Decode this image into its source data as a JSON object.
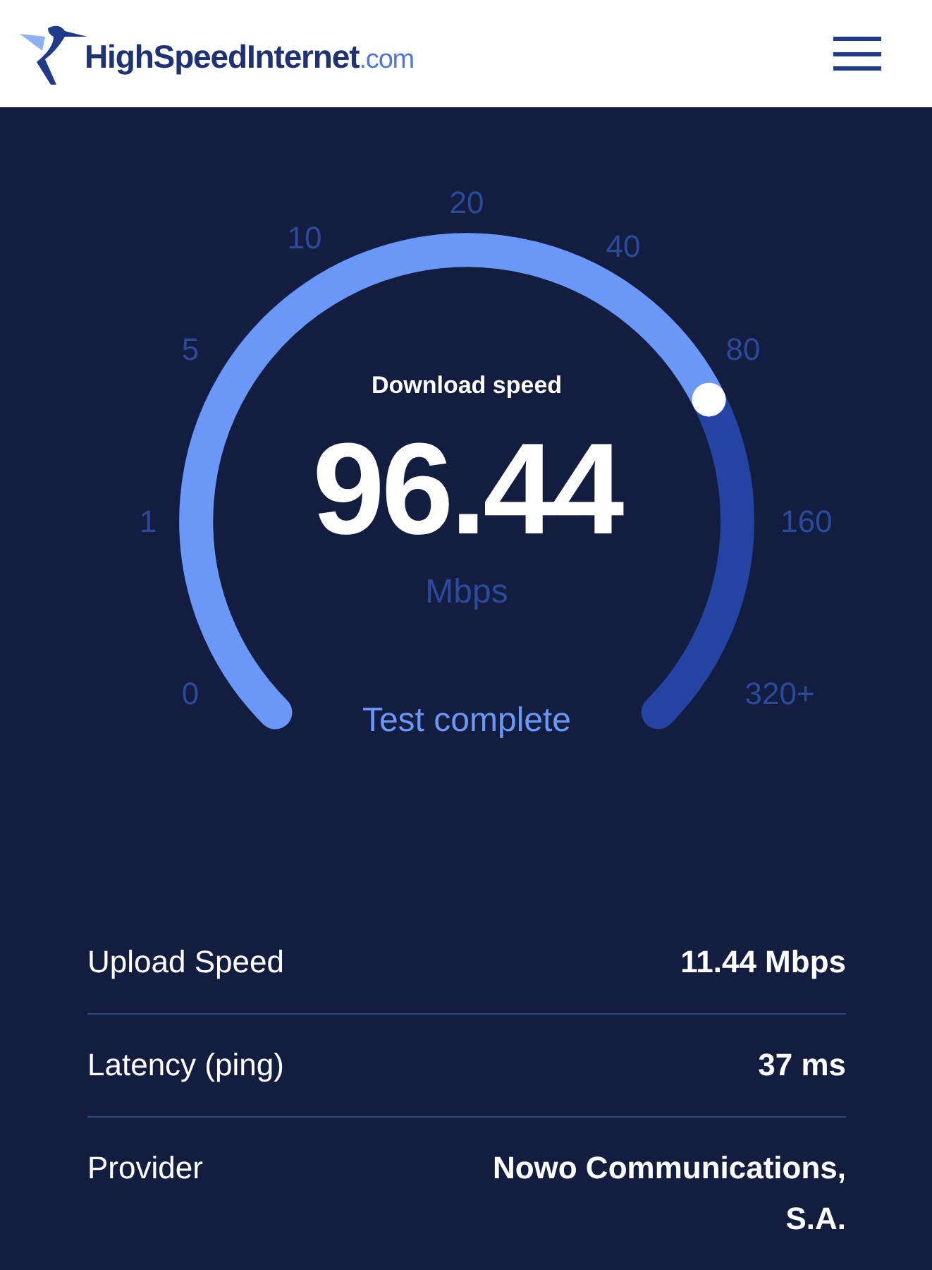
{
  "header": {
    "logo": {
      "brand": "HighSpeedInternet",
      "suffix": ".com"
    }
  },
  "gauge": {
    "label": "Download speed",
    "value": "96.44",
    "unit": "Mbps",
    "status": "Test complete",
    "scale": [
      "0",
      "1",
      "5",
      "10",
      "20",
      "40",
      "80",
      "160",
      "320+"
    ]
  },
  "results": [
    {
      "label": "Upload Speed",
      "value": "11.44 Mbps"
    },
    {
      "label": "Latency (ping)",
      "value": "37 ms"
    },
    {
      "label": "Provider",
      "value": "Nowo Communications, S.A."
    }
  ]
}
